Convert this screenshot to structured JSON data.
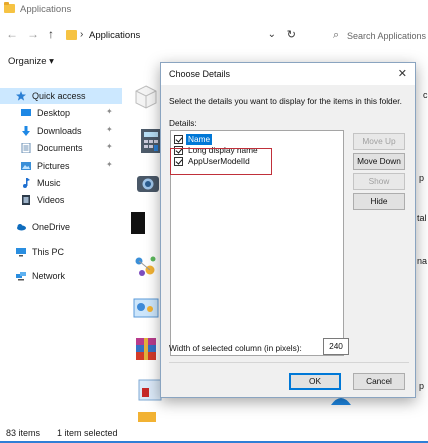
{
  "window": {
    "title": "Applications"
  },
  "nav": {
    "back_icon": "←",
    "forward_icon": "→",
    "up_icon": "↑",
    "breadcrumb_sep": "›",
    "breadcrumb": "Applications",
    "dropdown_icon": "⌄",
    "refresh_icon": "↻",
    "search_icon": "⌕",
    "search_placeholder": "Search Applications"
  },
  "toolbar": {
    "organize_label": "Organize ▾"
  },
  "sidebar": {
    "items": [
      {
        "label": "Quick access",
        "icon": "star-icon",
        "pinned": false,
        "selected": true
      },
      {
        "label": "Desktop",
        "icon": "desktop-icon",
        "pinned": true,
        "selected": false
      },
      {
        "label": "Downloads",
        "icon": "downloads-icon",
        "pinned": true,
        "selected": false
      },
      {
        "label": "Documents",
        "icon": "documents-icon",
        "pinned": true,
        "selected": false
      },
      {
        "label": "Pictures",
        "icon": "pictures-icon",
        "pinned": true,
        "selected": false
      },
      {
        "label": "Music",
        "icon": "music-icon",
        "pinned": false,
        "selected": false
      },
      {
        "label": "Videos",
        "icon": "videos-icon",
        "pinned": false,
        "selected": false
      },
      {
        "label": "OneDrive",
        "icon": "onedrive-icon",
        "pinned": false,
        "selected": false
      },
      {
        "label": "This PC",
        "icon": "this-pc-icon",
        "pinned": false,
        "selected": false
      },
      {
        "label": "Network",
        "icon": "network-icon",
        "pinned": false,
        "selected": false
      }
    ],
    "pin_glyph": "✦"
  },
  "content": {
    "partial_labels": [
      "ck",
      "p",
      "tal",
      "na",
      "p"
    ]
  },
  "status": {
    "item_count": "83 items",
    "selection": "1 item selected"
  },
  "dialog": {
    "title": "Choose Details",
    "close_icon": "✕",
    "instructions": "Select the details you want to display for the items in this folder.",
    "details_label": "Details:",
    "details": [
      {
        "label": "Name",
        "checked": true,
        "selected": true
      },
      {
        "label": "Long display name",
        "checked": true,
        "selected": false
      },
      {
        "label": "AppUserModelId",
        "checked": true,
        "selected": false
      }
    ],
    "buttons": {
      "move_up": "Move Up",
      "move_down": "Move Down",
      "show": "Show",
      "hide": "Hide",
      "ok": "OK",
      "cancel": "Cancel"
    },
    "width_label": "Width of selected column (in pixels):",
    "width_value": "240"
  }
}
